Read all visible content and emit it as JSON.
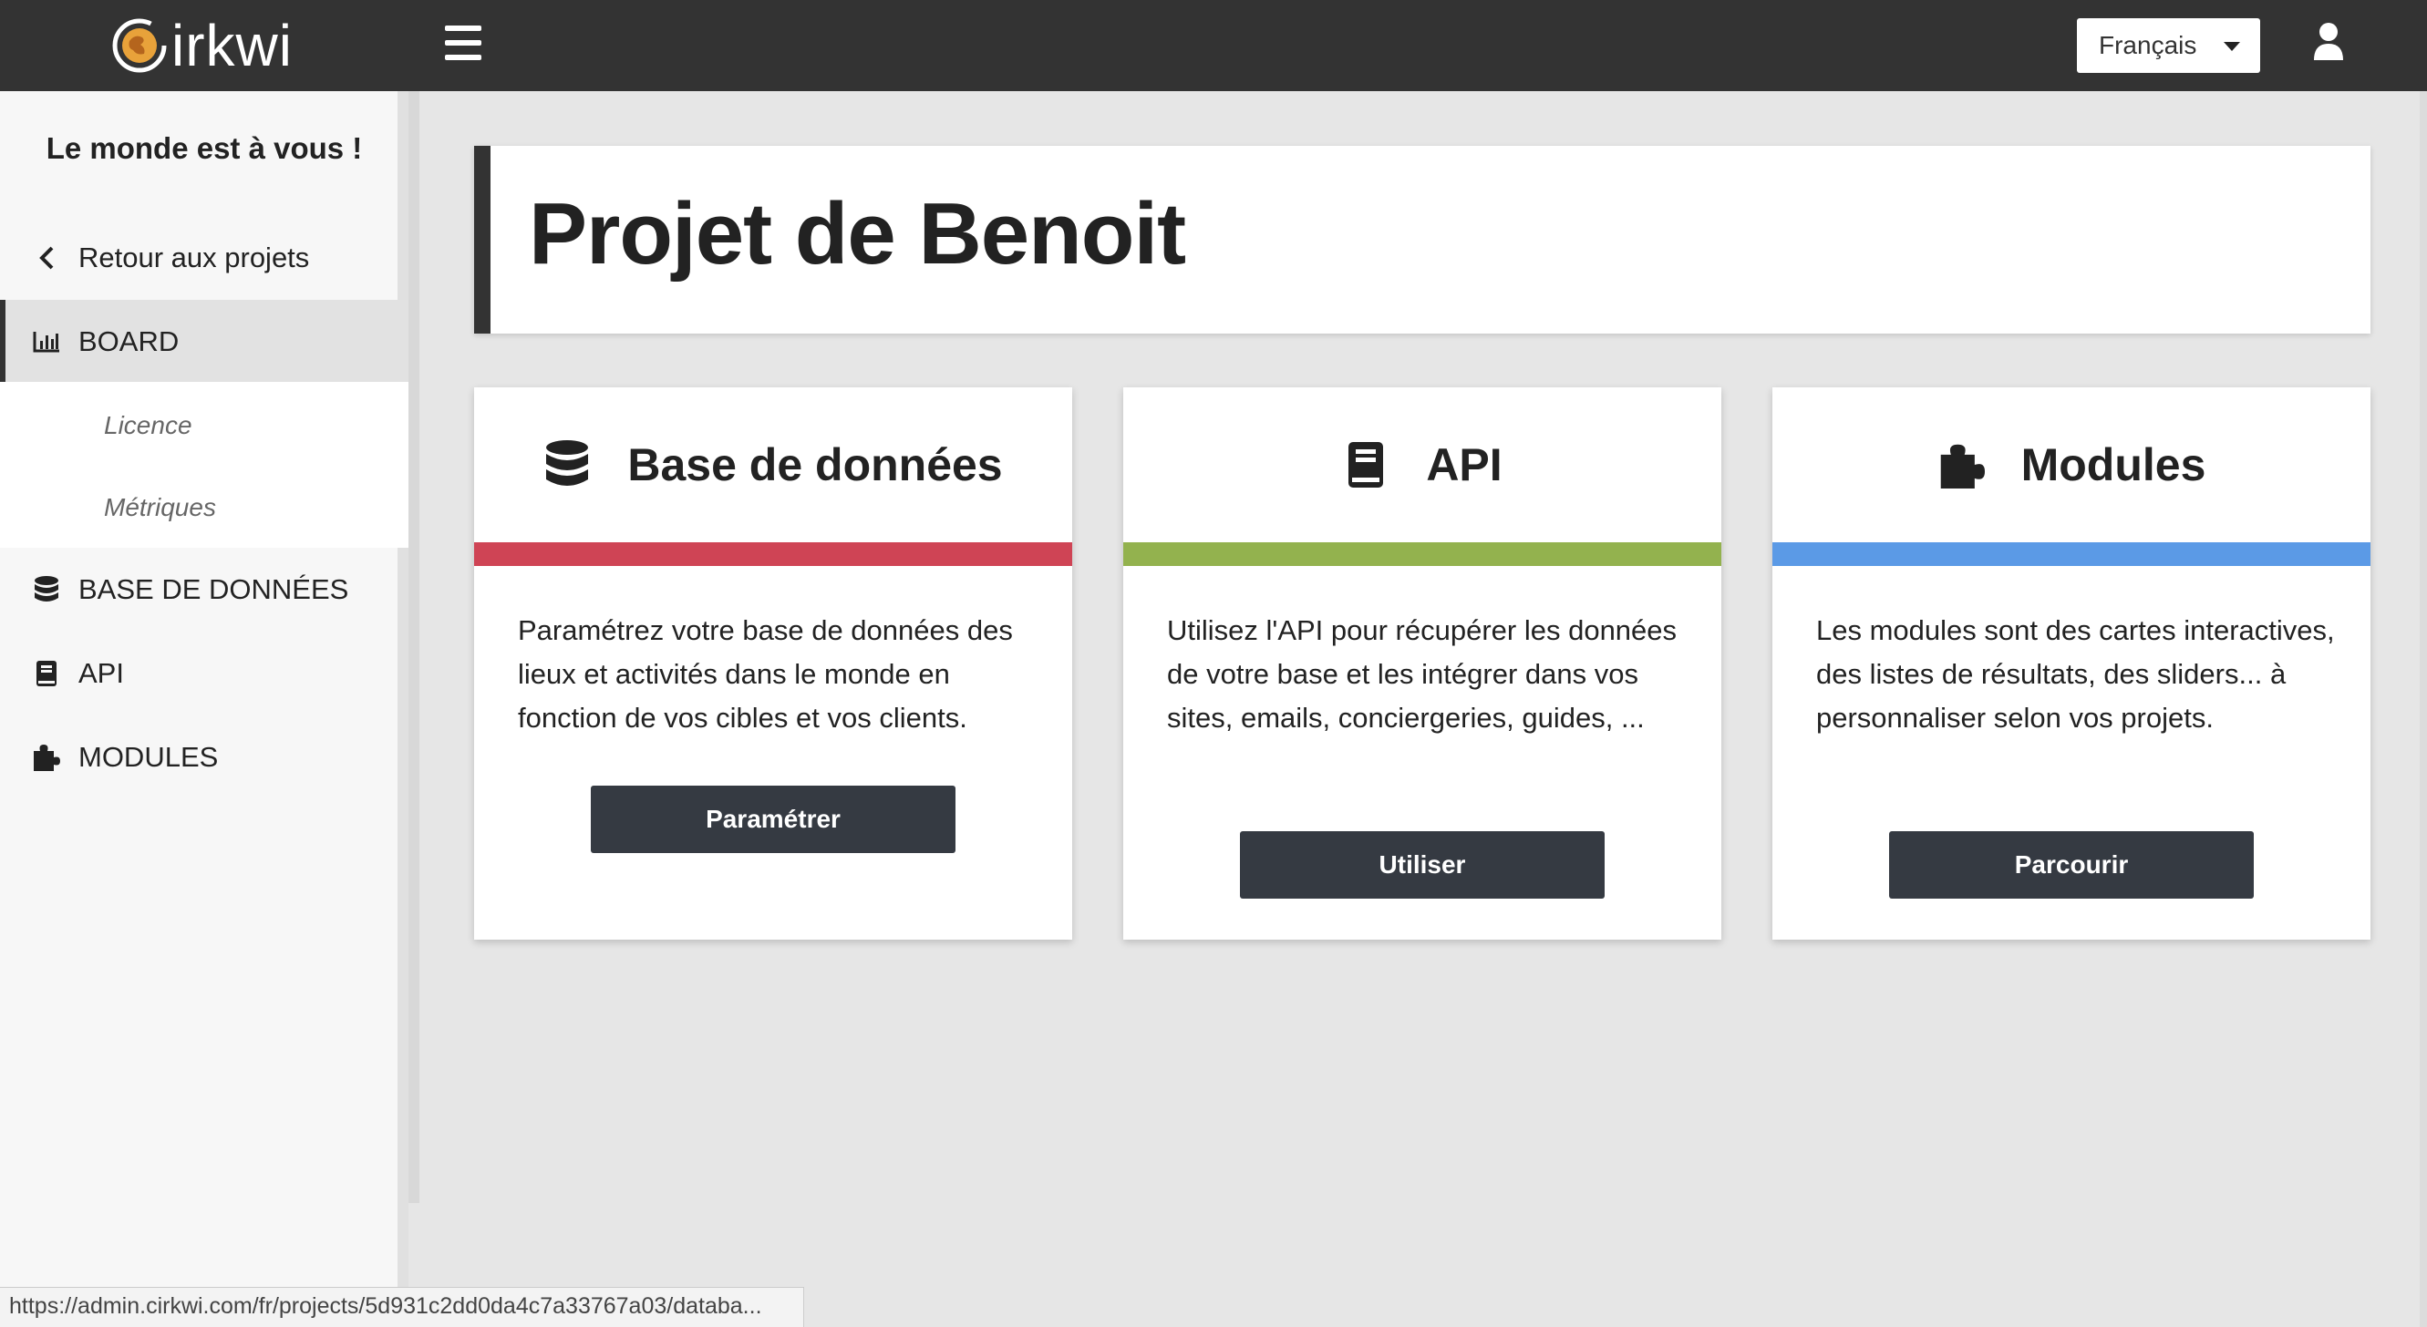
{
  "header": {
    "logo_text": "irkwi",
    "language": {
      "selected": "Français"
    }
  },
  "sidebar": {
    "tagline": "Le monde est à vous !",
    "back_label": "Retour aux projets",
    "items": [
      {
        "label": "BOARD",
        "icon": "bar-chart-icon",
        "active": true
      },
      {
        "label": "BASE DE DONNÉES",
        "icon": "database-icon"
      },
      {
        "label": "API",
        "icon": "book-icon"
      },
      {
        "label": "MODULES",
        "icon": "puzzle-icon"
      }
    ],
    "sub_items": [
      {
        "label": "Licence"
      },
      {
        "label": "Métriques"
      }
    ]
  },
  "main": {
    "title": "Projet de Benoit",
    "cards": [
      {
        "title": "Base de données",
        "icon": "database-icon",
        "accent": "#cf4455",
        "description": "Paramétrez votre base de données des lieux et activités dans le monde en fonction de vos cibles et vos clients.",
        "button": "Paramétrer"
      },
      {
        "title": "API",
        "icon": "book-icon",
        "accent": "#93b24e",
        "description": "Utilisez l'API pour récupérer les données de votre base et les intégrer dans vos sites, emails, conciergeries, guides, ...",
        "button": "Utiliser"
      },
      {
        "title": "Modules",
        "icon": "puzzle-icon",
        "accent": "#5b9ae6",
        "description": "Les modules sont des cartes interactives, des listes de résultats, des sliders... à personnaliser selon vos projets.",
        "button": "Parcourir"
      }
    ]
  },
  "status_bar": {
    "url": "https://admin.cirkwi.com/fr/projects/5d931c2dd0da4c7a33767a03/databa..."
  }
}
